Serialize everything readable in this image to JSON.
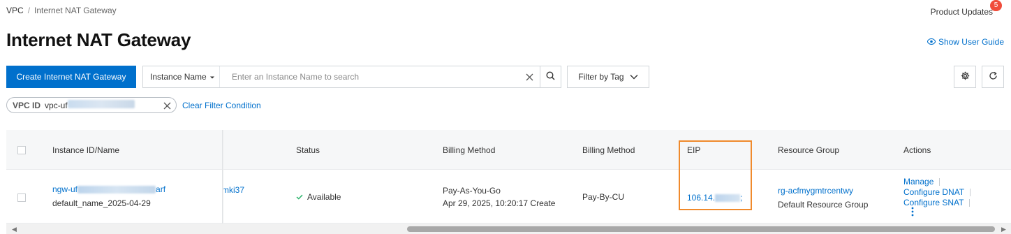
{
  "breadcrumb": {
    "root": "VPC",
    "separator": "/",
    "current": "Internet NAT Gateway"
  },
  "header": {
    "product_updates": "Product Updates",
    "updates_count": "5",
    "title": "Internet NAT Gateway",
    "user_guide": "Show User Guide"
  },
  "toolbar": {
    "create_button": "Create Internet NAT Gateway",
    "search_field": "Instance Name",
    "search_placeholder": "Enter an Instance Name to search",
    "filter_by_tag": "Filter by Tag"
  },
  "filters": {
    "chip_key": "VPC ID",
    "chip_value_visible": "vpc-uf",
    "clear_label": "Clear Filter Condition"
  },
  "table": {
    "columns": {
      "instance": "Instance ID/Name",
      "status": "Status",
      "billing1": "Billing Method",
      "billing2": "Billing Method",
      "eip": "EIP",
      "resource_group": "Resource Group",
      "actions": "Actions"
    },
    "rows": [
      {
        "id_prefix": "ngw-uf",
        "id_suffix": "arf",
        "name": "default_name_2025-04-29",
        "partial_col": "mki37",
        "status": "Available",
        "billing_method": "Pay-As-You-Go",
        "created": "Apr 29, 2025, 10:20:17 Create",
        "billing_metric": "Pay-By-CU",
        "eip_prefix": "106.14.",
        "eip_suffix": ";",
        "resource_group_id": "rg-acfmygmtrcentwy",
        "resource_group_name": "Default Resource Group",
        "actions": [
          "Manage",
          "Configure DNAT",
          "Configure SNAT"
        ]
      }
    ]
  },
  "colors": {
    "accent": "#0070cc",
    "highlight": "#f08a2c",
    "badge": "#f04d3c",
    "success": "#2bb36b"
  }
}
